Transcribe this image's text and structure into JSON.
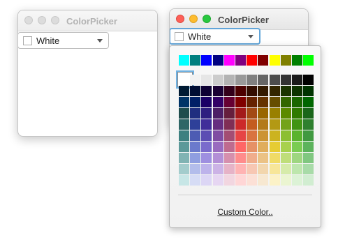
{
  "windows": [
    {
      "title": "ColorPicker",
      "combo": {
        "value": "White"
      }
    },
    {
      "title": "ColorPicker",
      "combo": {
        "value": "White"
      }
    }
  ],
  "popup": {
    "custom_color_label": "Custom Color..",
    "top_row_colors": [
      "#00ffff",
      "#008080",
      "#0000ff",
      "#000080",
      "#ff00ff",
      "#800080",
      "#ff0000",
      "#800000",
      "#ffff00",
      "#808000",
      "#008000",
      "#00ff00"
    ],
    "grid_rows": [
      [
        "#ffffff",
        "#f2f2f2",
        "#e6e6e6",
        "#cccccc",
        "#b3b3b3",
        "#999999",
        "#808080",
        "#666666",
        "#4d4d4d",
        "#333333",
        "#1a1a1a",
        "#000000"
      ],
      [
        "#001a33",
        "#000d33",
        "#0d0033",
        "#1a0033",
        "#33001a",
        "#4d0000",
        "#330d00",
        "#331a00",
        "#332600",
        "#1a3300",
        "#0d3300",
        "#003300"
      ],
      [
        "#003366",
        "#001f66",
        "#1a0066",
        "#330066",
        "#660033",
        "#800000",
        "#662200",
        "#663300",
        "#664d00",
        "#336600",
        "#1a6600",
        "#006600"
      ],
      [
        "#1f4d4d",
        "#1f2e80",
        "#2e1f80",
        "#4d1f66",
        "#661f3d",
        "#a31a1a",
        "#a34a14",
        "#996600",
        "#998000",
        "#5c8a00",
        "#2e7a00",
        "#1a661a"
      ],
      [
        "#2e6666",
        "#2e4099",
        "#402e99",
        "#662e80",
        "#802e55",
        "#cc2929",
        "#c45c1f",
        "#b37a1a",
        "#b39914",
        "#73a31a",
        "#409414",
        "#2e802e"
      ],
      [
        "#3d8080",
        "#4d5cb3",
        "#5c4db3",
        "#804da3",
        "#a34d73",
        "#e64545",
        "#d97340",
        "#cc9433",
        "#ccb31f",
        "#8cbf33",
        "#5ab32e",
        "#409940"
      ],
      [
        "#5c9999",
        "#6b7acc",
        "#7a6bcc",
        "#996bbf",
        "#bf6b8f",
        "#ff6666",
        "#e69166",
        "#e0ad5c",
        "#e6cc33",
        "#a8d14d",
        "#7acc52",
        "#5cb35c"
      ],
      [
        "#80b3b3",
        "#8f9ee0",
        "#9e8fe0",
        "#b38fd6",
        "#d68fad",
        "#ff8c8c",
        "#f0ad8c",
        "#ebc285",
        "#f0db66",
        "#bfde7a",
        "#9ed680",
        "#80c780"
      ],
      [
        "#a3cccc",
        "#b3bdeb",
        "#bdb3eb",
        "#ccb3e6",
        "#e6b3c7",
        "#ffb3b3",
        "#f7c7b3",
        "#f2d6ad",
        "#f7e699",
        "#d6ebaa",
        "#bde6ad",
        "#a8dba8"
      ],
      [
        "#c7e6e6",
        "#d6dcf5",
        "#dcd6f5",
        "#e6d6f2",
        "#f2d6e0",
        "#ffd6d6",
        "#fce0d6",
        "#f7e8d1",
        "#fcf2c7",
        "#ebf5d1",
        "#dcf2d6",
        "#d1edd1"
      ]
    ]
  }
}
